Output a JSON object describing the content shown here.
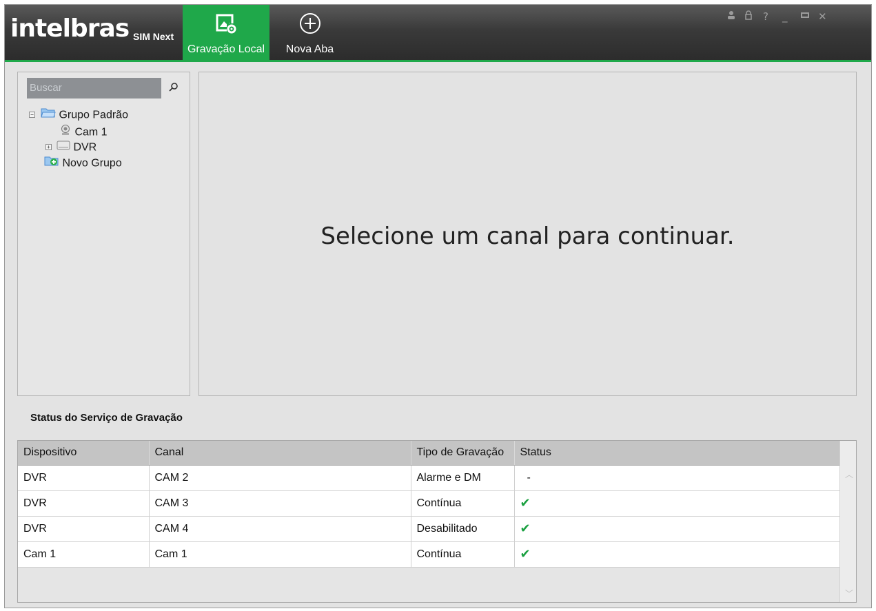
{
  "app": {
    "logo": "intelbras",
    "product": "SIM Next"
  },
  "tabs": [
    {
      "label": "Gravação Local",
      "icon": "folder-settings-icon",
      "active": true
    },
    {
      "label": "Nova Aba",
      "icon": "plus-circle-icon",
      "active": false
    }
  ],
  "window_controls": {
    "user": "user-icon",
    "lock": "lock-icon",
    "help": "?",
    "minimize": "_",
    "maximize": "maximize-icon",
    "close": "✕"
  },
  "sidebar": {
    "search_placeholder": "Buscar",
    "tree": {
      "group": "Grupo Padrão",
      "cam": "Cam 1",
      "dvr": "DVR",
      "new_group": "Novo Grupo"
    }
  },
  "main": {
    "message": "Selecione um canal para continuar."
  },
  "status": {
    "title": "Status do Serviço de Gravação",
    "columns": [
      "Dispositivo",
      "Canal",
      "Tipo de Gravação",
      "Status"
    ],
    "rows": [
      {
        "device": "DVR",
        "channel": "CAM 2",
        "type": "Alarme e DM",
        "status": "-"
      },
      {
        "device": "DVR",
        "channel": "CAM 3",
        "type": "Contínua",
        "status": "✔"
      },
      {
        "device": "DVR",
        "channel": "CAM 4",
        "type": "Desabilitado",
        "status": "✔"
      },
      {
        "device": "Cam 1",
        "channel": "Cam 1",
        "type": "Contínua",
        "status": "✔"
      }
    ]
  },
  "colors": {
    "accent": "#1fa84a",
    "titlebar": "#3a3a3a",
    "check": "#1aa040"
  }
}
